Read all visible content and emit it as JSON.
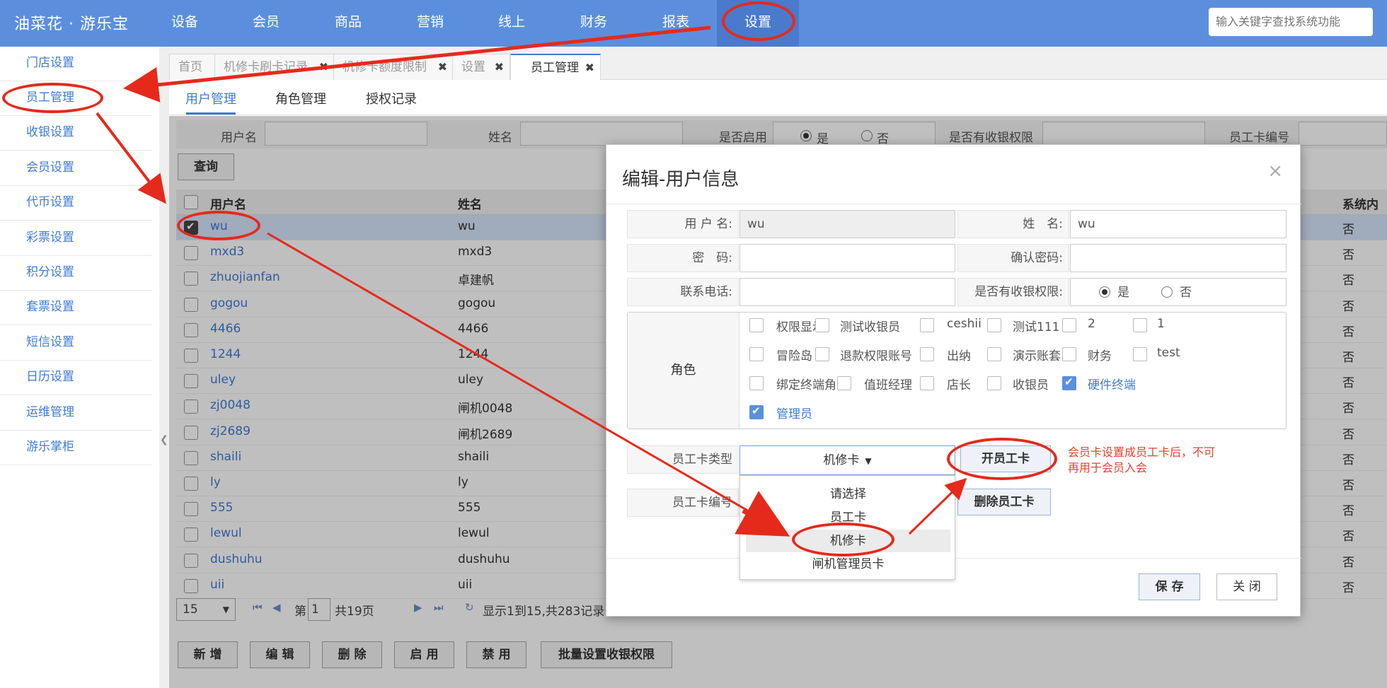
{
  "app": {
    "logo": "油菜花 · 游乐宝",
    "search_placeholder": "输入关键字查找系统功能"
  },
  "nav": [
    "设备",
    "会员",
    "商品",
    "营销",
    "线上",
    "财务",
    "报表",
    "设置"
  ],
  "sidebar": [
    "门店设置",
    "员工管理",
    "收银设置",
    "会员设置",
    "代币设置",
    "彩票设置",
    "积分设置",
    "套票设置",
    "短信设置",
    "日历设置",
    "运维管理",
    "游乐掌柜"
  ],
  "tabs": [
    {
      "label": "首页",
      "closable": false
    },
    {
      "label": "机修卡刷卡记录",
      "closable": true
    },
    {
      "label": "机修卡额度限制",
      "closable": true
    },
    {
      "label": "设置",
      "closable": true
    },
    {
      "label": "员工管理",
      "closable": true,
      "active": true
    }
  ],
  "subtabs": [
    "用户管理",
    "角色管理",
    "授权记录"
  ],
  "filters": {
    "username": "用户名",
    "name": "姓名",
    "enabled": "是否启用",
    "cashier": "是否有收银权限",
    "cardno": "员工卡编号",
    "yes": "是",
    "no": "否",
    "query": "查询"
  },
  "table": {
    "headers": [
      "用户名",
      "姓名",
      "系统内置"
    ],
    "rows": [
      {
        "user": "wu",
        "name": "wu",
        "builtin": "否",
        "selected": true
      },
      {
        "user": "mxd3",
        "name": "mxd3",
        "builtin": "否"
      },
      {
        "user": "zhuojianfan",
        "name": "卓建帆",
        "builtin": "否"
      },
      {
        "user": "gogou",
        "name": "gogou",
        "builtin": "否"
      },
      {
        "user": "4466",
        "name": "4466",
        "builtin": "否"
      },
      {
        "user": "1244",
        "name": "1244",
        "builtin": "否"
      },
      {
        "user": "uley",
        "name": "uley",
        "builtin": "否"
      },
      {
        "user": "zj0048",
        "name": "闸机0048",
        "builtin": "否"
      },
      {
        "user": "zj2689",
        "name": "闸机2689",
        "builtin": "否"
      },
      {
        "user": "shaili",
        "name": "shaili",
        "builtin": "否"
      },
      {
        "user": "ly",
        "name": "ly",
        "builtin": "否"
      },
      {
        "user": "555",
        "name": "555",
        "builtin": "否"
      },
      {
        "user": "lewul",
        "name": "lewul",
        "builtin": "否"
      },
      {
        "user": "dushuhu",
        "name": "dushuhu",
        "builtin": "否"
      },
      {
        "user": "uii",
        "name": "uii",
        "builtin": "否"
      }
    ]
  },
  "pager": {
    "page_size": "15",
    "page_prefix": "第",
    "page": "1",
    "total_pages": "共19页",
    "summary": "显示1到15,共283记录"
  },
  "actions": [
    "新 增",
    "编 辑",
    "删 除",
    "启 用",
    "禁 用",
    "批量设置收银权限"
  ],
  "modal": {
    "title": "编辑-用户信息",
    "close": "×",
    "username_label": "用 户 名:",
    "username_value": "wu",
    "name_label": "姓　名:",
    "name_value": "wu",
    "password_label": "密　码:",
    "confirm_label": "确认密码:",
    "phone_label": "联系电话:",
    "cashier_label": "是否有收银权限:",
    "yes": "是",
    "no": "否",
    "roles_label": "角色",
    "roles": [
      [
        {
          "t": "权限显示"
        },
        {
          "t": "测试收银员"
        },
        {
          "t": "ceshii"
        },
        {
          "t": "测试111"
        },
        {
          "t": "2"
        },
        {
          "t": "1"
        }
      ],
      [
        {
          "t": "冒险岛"
        },
        {
          "t": "退款权限账号"
        },
        {
          "t": "出纳"
        },
        {
          "t": "演示账套"
        },
        {
          "t": "财务"
        },
        {
          "t": "test"
        }
      ],
      [
        {
          "t": "绑定终端角色"
        },
        {
          "t": "值班经理"
        },
        {
          "t": "店长"
        },
        {
          "t": "收银员"
        },
        {
          "t": "硬件终端",
          "on": true
        }
      ],
      [
        {
          "t": "管理员",
          "on": true
        }
      ]
    ],
    "card_type_label": "员工卡类型",
    "card_type_value": "机修卡",
    "card_no_label": "员工卡编号",
    "dropdown": [
      "请选择",
      "员工卡",
      "机修卡",
      "闸机管理员卡"
    ],
    "open_card": "开员工卡",
    "delete_card": "删除员工卡",
    "note": "会员卡设置成员工卡后，不可再用于会员入会",
    "save": "保 存",
    "close_btn": "关 闭"
  }
}
